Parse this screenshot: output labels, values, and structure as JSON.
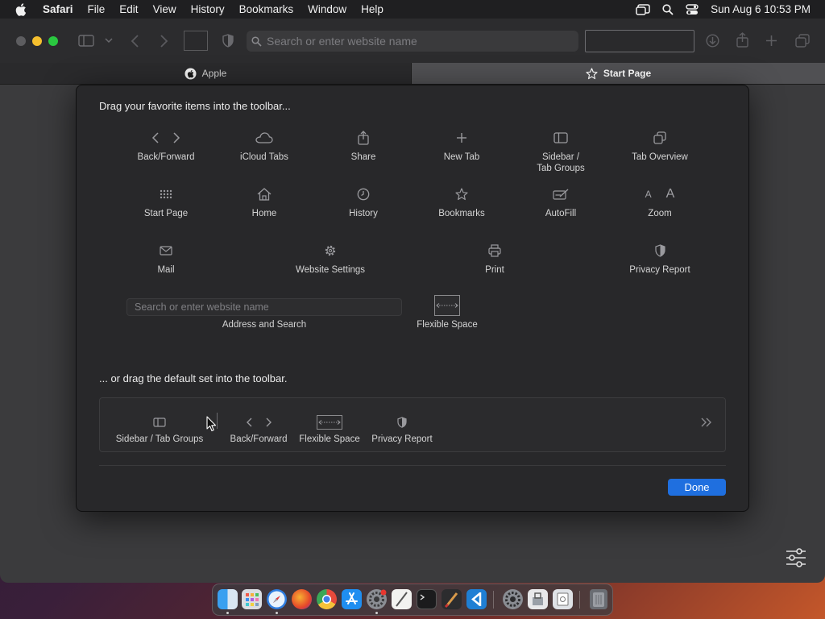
{
  "menubar": {
    "app": "Safari",
    "items": [
      "File",
      "Edit",
      "View",
      "History",
      "Bookmarks",
      "Window",
      "Help"
    ],
    "clock": "Sun Aug 6  10:53 PM"
  },
  "toolbar": {
    "address_placeholder": "Search or enter website name"
  },
  "tabs": [
    {
      "label": "Apple",
      "icon": "apple-icon"
    },
    {
      "label": "Start Page",
      "icon": "star-icon",
      "active": true
    }
  ],
  "sheet": {
    "title": "Drag your favorite items into the toolbar...",
    "items": {
      "back_forward": "Back/Forward",
      "icloud_tabs": "iCloud Tabs",
      "share": "Share",
      "new_tab": "New Tab",
      "sidebar_line1": "Sidebar /",
      "sidebar_line2": "Tab Groups",
      "tab_overview": "Tab Overview",
      "start_page": "Start Page",
      "home": "Home",
      "history": "History",
      "bookmarks": "Bookmarks",
      "autofill": "AutoFill",
      "zoom": "Zoom",
      "zoom_small": "A",
      "zoom_large": "A",
      "mail": "Mail",
      "website_settings": "Website Settings",
      "print": "Print",
      "privacy_report": "Privacy Report",
      "address_placeholder": "Search or enter website name",
      "address_and_search": "Address and Search",
      "flexible_space": "Flexible Space"
    },
    "default_title": "... or drag the default set into the toolbar.",
    "default_set": {
      "sidebar": "Sidebar / Tab Groups",
      "back_forward": "Back/Forward",
      "flexible_space": "Flexible Space",
      "privacy_report": "Privacy Report"
    },
    "done_label": "Done"
  },
  "colors": {
    "accent": "#1f6fdf",
    "traffic_min": "#f5bf2e",
    "traffic_max": "#2ac840"
  },
  "dock": {
    "apps": [
      "finder-icon",
      "launchpad-icon",
      "safari-icon",
      "firefox-icon",
      "chrome-icon",
      "app-store-icon",
      "system-settings-icon",
      "textedit-icon",
      "terminal-icon",
      "paintbrush-icon",
      "vscode-icon",
      "settings-icon",
      "preview-icon",
      "script-icon",
      "trash-icon"
    ]
  }
}
